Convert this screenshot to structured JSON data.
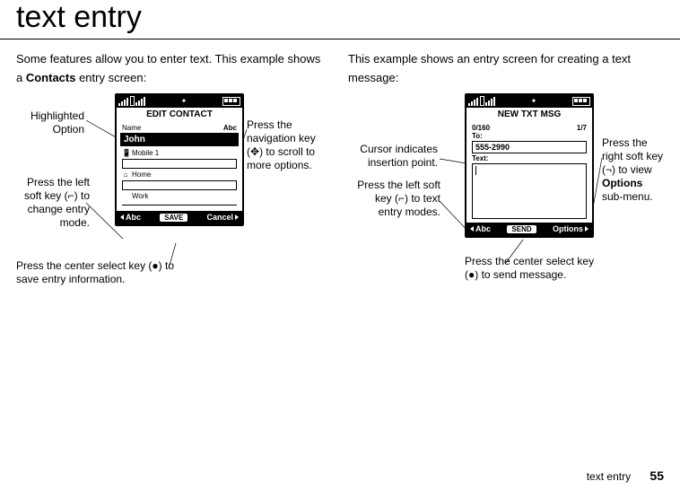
{
  "page_title": "text entry",
  "left": {
    "intro_a": "Some features allow you to enter text. This example shows a ",
    "intro_b": "Contacts",
    "intro_c": " entry screen:",
    "phone": {
      "title": "EDIT CONTACT",
      "name_label": "Name",
      "mode": "Abc",
      "highlighted": "John",
      "mobile_icon": "📱",
      "mobile_label": "Mobile 1",
      "home_icon": "⌂",
      "home_label": "Home",
      "work_label": "Work",
      "sk_left": "Abc",
      "sk_mid": "SAVE",
      "sk_right": "Cancel"
    },
    "ann": {
      "highlighted": "Highlighted\nOption",
      "left_soft": "Press the left soft key (",
      "left_soft2": ") to change entry mode.",
      "center": "Press the center select key (",
      "center2": ") to save entry information.",
      "nav": "Press the navigation key (",
      "nav2": ") to scroll to more options."
    }
  },
  "right": {
    "intro": "This example shows an entry screen for creating a text message:",
    "phone": {
      "title": "NEW TXT MSG",
      "count": "0/160",
      "page": "1/7",
      "to_label": "To:",
      "to_value": "555-2990",
      "text_label": "Text:",
      "sk_left": "Abc",
      "sk_mid": "SEND",
      "sk_right": "Options"
    },
    "ann": {
      "cursor": "Cursor indicates insertion point.",
      "left_soft": "Press the left soft key (",
      "left_soft2": ") to text entry modes.",
      "center": "Press the center select key (",
      "center2": ") to send message.",
      "right_soft": "Press the right soft key (",
      "right_soft2": ") to view ",
      "right_soft3": "Options",
      "right_soft4": " sub-menu."
    }
  },
  "footer": {
    "label": "text entry",
    "page": "55"
  },
  "glyphs": {
    "lsk": "⌐",
    "rsk": "¬",
    "nav": "✥",
    "center": "●"
  }
}
